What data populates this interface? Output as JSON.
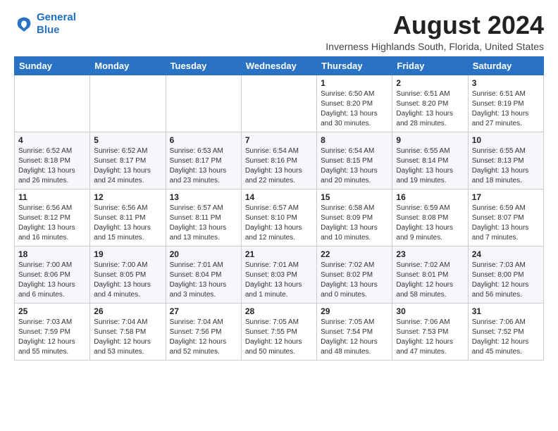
{
  "header": {
    "logo_line1": "General",
    "logo_line2": "Blue",
    "main_title": "August 2024",
    "subtitle": "Inverness Highlands South, Florida, United States"
  },
  "days_of_week": [
    "Sunday",
    "Monday",
    "Tuesday",
    "Wednesday",
    "Thursday",
    "Friday",
    "Saturday"
  ],
  "weeks": [
    [
      {
        "day": "",
        "info": ""
      },
      {
        "day": "",
        "info": ""
      },
      {
        "day": "",
        "info": ""
      },
      {
        "day": "",
        "info": ""
      },
      {
        "day": "1",
        "info": "Sunrise: 6:50 AM\nSunset: 8:20 PM\nDaylight: 13 hours\nand 30 minutes."
      },
      {
        "day": "2",
        "info": "Sunrise: 6:51 AM\nSunset: 8:20 PM\nDaylight: 13 hours\nand 28 minutes."
      },
      {
        "day": "3",
        "info": "Sunrise: 6:51 AM\nSunset: 8:19 PM\nDaylight: 13 hours\nand 27 minutes."
      }
    ],
    [
      {
        "day": "4",
        "info": "Sunrise: 6:52 AM\nSunset: 8:18 PM\nDaylight: 13 hours\nand 26 minutes."
      },
      {
        "day": "5",
        "info": "Sunrise: 6:52 AM\nSunset: 8:17 PM\nDaylight: 13 hours\nand 24 minutes."
      },
      {
        "day": "6",
        "info": "Sunrise: 6:53 AM\nSunset: 8:17 PM\nDaylight: 13 hours\nand 23 minutes."
      },
      {
        "day": "7",
        "info": "Sunrise: 6:54 AM\nSunset: 8:16 PM\nDaylight: 13 hours\nand 22 minutes."
      },
      {
        "day": "8",
        "info": "Sunrise: 6:54 AM\nSunset: 8:15 PM\nDaylight: 13 hours\nand 20 minutes."
      },
      {
        "day": "9",
        "info": "Sunrise: 6:55 AM\nSunset: 8:14 PM\nDaylight: 13 hours\nand 19 minutes."
      },
      {
        "day": "10",
        "info": "Sunrise: 6:55 AM\nSunset: 8:13 PM\nDaylight: 13 hours\nand 18 minutes."
      }
    ],
    [
      {
        "day": "11",
        "info": "Sunrise: 6:56 AM\nSunset: 8:12 PM\nDaylight: 13 hours\nand 16 minutes."
      },
      {
        "day": "12",
        "info": "Sunrise: 6:56 AM\nSunset: 8:11 PM\nDaylight: 13 hours\nand 15 minutes."
      },
      {
        "day": "13",
        "info": "Sunrise: 6:57 AM\nSunset: 8:11 PM\nDaylight: 13 hours\nand 13 minutes."
      },
      {
        "day": "14",
        "info": "Sunrise: 6:57 AM\nSunset: 8:10 PM\nDaylight: 13 hours\nand 12 minutes."
      },
      {
        "day": "15",
        "info": "Sunrise: 6:58 AM\nSunset: 8:09 PM\nDaylight: 13 hours\nand 10 minutes."
      },
      {
        "day": "16",
        "info": "Sunrise: 6:59 AM\nSunset: 8:08 PM\nDaylight: 13 hours\nand 9 minutes."
      },
      {
        "day": "17",
        "info": "Sunrise: 6:59 AM\nSunset: 8:07 PM\nDaylight: 13 hours\nand 7 minutes."
      }
    ],
    [
      {
        "day": "18",
        "info": "Sunrise: 7:00 AM\nSunset: 8:06 PM\nDaylight: 13 hours\nand 6 minutes."
      },
      {
        "day": "19",
        "info": "Sunrise: 7:00 AM\nSunset: 8:05 PM\nDaylight: 13 hours\nand 4 minutes."
      },
      {
        "day": "20",
        "info": "Sunrise: 7:01 AM\nSunset: 8:04 PM\nDaylight: 13 hours\nand 3 minutes."
      },
      {
        "day": "21",
        "info": "Sunrise: 7:01 AM\nSunset: 8:03 PM\nDaylight: 13 hours\nand 1 minute."
      },
      {
        "day": "22",
        "info": "Sunrise: 7:02 AM\nSunset: 8:02 PM\nDaylight: 13 hours\nand 0 minutes."
      },
      {
        "day": "23",
        "info": "Sunrise: 7:02 AM\nSunset: 8:01 PM\nDaylight: 12 hours\nand 58 minutes."
      },
      {
        "day": "24",
        "info": "Sunrise: 7:03 AM\nSunset: 8:00 PM\nDaylight: 12 hours\nand 56 minutes."
      }
    ],
    [
      {
        "day": "25",
        "info": "Sunrise: 7:03 AM\nSunset: 7:59 PM\nDaylight: 12 hours\nand 55 minutes."
      },
      {
        "day": "26",
        "info": "Sunrise: 7:04 AM\nSunset: 7:58 PM\nDaylight: 12 hours\nand 53 minutes."
      },
      {
        "day": "27",
        "info": "Sunrise: 7:04 AM\nSunset: 7:56 PM\nDaylight: 12 hours\nand 52 minutes."
      },
      {
        "day": "28",
        "info": "Sunrise: 7:05 AM\nSunset: 7:55 PM\nDaylight: 12 hours\nand 50 minutes."
      },
      {
        "day": "29",
        "info": "Sunrise: 7:05 AM\nSunset: 7:54 PM\nDaylight: 12 hours\nand 48 minutes."
      },
      {
        "day": "30",
        "info": "Sunrise: 7:06 AM\nSunset: 7:53 PM\nDaylight: 12 hours\nand 47 minutes."
      },
      {
        "day": "31",
        "info": "Sunrise: 7:06 AM\nSunset: 7:52 PM\nDaylight: 12 hours\nand 45 minutes."
      }
    ]
  ]
}
